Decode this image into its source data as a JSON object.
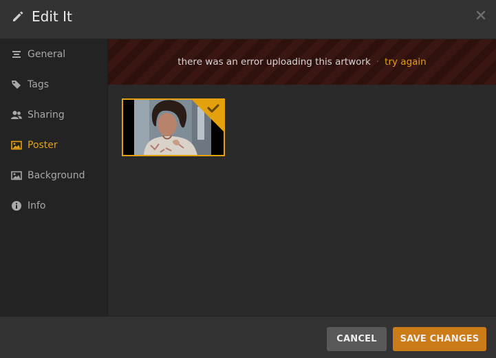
{
  "header": {
    "title": "Edit It",
    "title_icon": "pencil-icon",
    "close_icon": "close-icon"
  },
  "sidebar": {
    "items": [
      {
        "label": "General",
        "icon": "lines-icon",
        "active": false
      },
      {
        "label": "Tags",
        "icon": "tags-icon",
        "active": false
      },
      {
        "label": "Sharing",
        "icon": "users-icon",
        "active": false
      },
      {
        "label": "Poster",
        "icon": "image-icon",
        "active": true
      },
      {
        "label": "Background",
        "icon": "image-icon",
        "active": false
      },
      {
        "label": "Info",
        "icon": "info-icon",
        "active": false
      }
    ]
  },
  "main": {
    "error": {
      "message": "there was an error uploading this artwork",
      "separator": "·",
      "retry_label": "try again"
    },
    "poster": {
      "selected": true,
      "check_icon": "checkmark-icon"
    }
  },
  "footer": {
    "cancel_label": "CANCEL",
    "save_label": "SAVE CHANGES"
  },
  "colors": {
    "accent": "#e5a00d",
    "save_button": "#cc7b19",
    "cancel_button": "#595959",
    "header_bg": "#333333",
    "sidebar_bg": "#232323",
    "content_bg": "#2a2a2a",
    "error_stripe": "#3a1612"
  }
}
